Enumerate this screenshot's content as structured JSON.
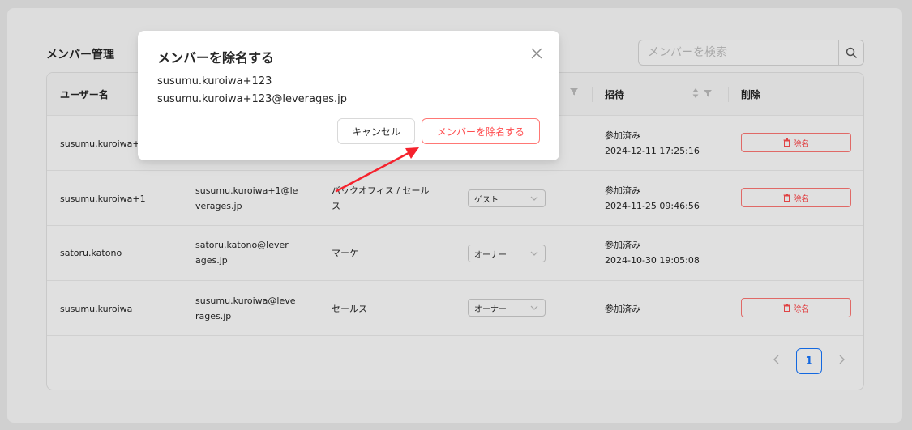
{
  "page": {
    "title": "メンバー管理",
    "search": {
      "placeholder": "メンバーを検索"
    }
  },
  "table": {
    "headers": {
      "username": "ユーザー名",
      "invite": "招待",
      "delete": "削除"
    },
    "rows": [
      {
        "username": "susumu.kuroiwa+",
        "email": "",
        "department": "",
        "role": "",
        "invite_status": "参加済み",
        "invite_date": "2024-12-11 17:25:16",
        "delete_label": "除名"
      },
      {
        "username": "susumu.kuroiwa+1",
        "email_line1": "susumu.kuroiwa+1@le",
        "email_line2": "verages.jp",
        "dept_line1": "バックオフィス / セール",
        "dept_line2": "ス",
        "role": "ゲスト",
        "invite_status": "参加済み",
        "invite_date": "2024-11-25 09:46:56",
        "delete_label": "除名"
      },
      {
        "username": "satoru.katono",
        "email_line1": "satoru.katono@lever",
        "email_line2": "ages.jp",
        "dept_line1": "マーケ",
        "role": "オーナー",
        "invite_status": "参加済み",
        "invite_date": "2024-10-30 19:05:08"
      },
      {
        "username": "susumu.kuroiwa",
        "email_line1": "susumu.kuroiwa@leve",
        "email_line2": "rages.jp",
        "dept_line1": "セールス",
        "role": "オーナー",
        "invite_status": "参加済み",
        "delete_label": "除名"
      }
    ]
  },
  "pagination": {
    "current": "1"
  },
  "modal": {
    "title": "メンバーを除名する",
    "username": "susumu.kuroiwa+123",
    "email": "susumu.kuroiwa+123@leverages.jp",
    "cancel_label": "キャンセル",
    "confirm_label": "メンバーを除名する"
  },
  "colors": {
    "danger": "#ff4d4f",
    "primary": "#1677ff",
    "arrow": "#f5222d"
  }
}
